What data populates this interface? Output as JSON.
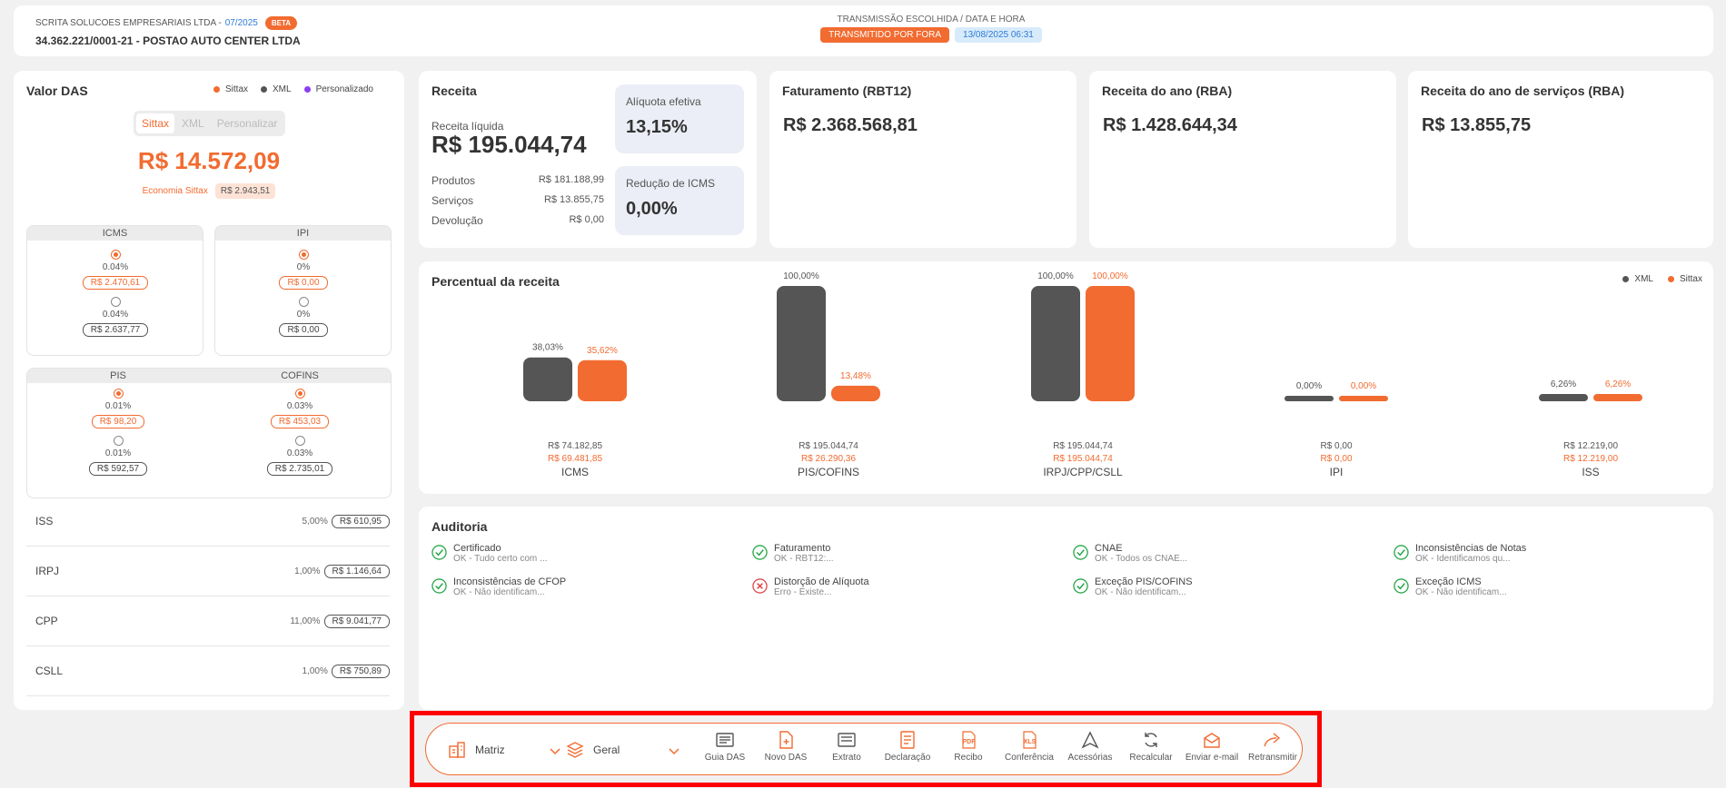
{
  "header": {
    "company": "SCRITA SOLUCOES EMPRESARIAIS LTDA -",
    "period": "07/2025",
    "beta": "BETA",
    "cnpj": "34.362.221/0001-21 - POSTAO AUTO CENTER LTDA",
    "transmission_label": "TRANSMISSÃO ESCOLHIDA / DATA E HORA",
    "transmission_status": "TRANSMITIDO POR FORA",
    "transmission_date": "13/08/2025 06:31"
  },
  "das": {
    "title": "Valor DAS",
    "legend": [
      {
        "label": "Sittax",
        "color": "#f26b30"
      },
      {
        "label": "XML",
        "color": "#555555"
      },
      {
        "label": "Personalizado",
        "color": "#8b3df2"
      }
    ],
    "tabs": [
      "Sittax",
      "XML",
      "Personalizar"
    ],
    "active_tab": "Sittax",
    "value": "R$ 14.572,09",
    "economy_label": "Economia Sittax",
    "economy_value": "R$ 2.943,51",
    "taxes": {
      "icms": {
        "title": "ICMS",
        "p1": "0.04%",
        "v1": "R$ 2.470,61",
        "p2": "0.04%",
        "v2": "R$ 2.637,77"
      },
      "ipi": {
        "title": "IPI",
        "p1": "0%",
        "v1": "R$ 0,00",
        "p2": "0%",
        "v2": "R$ 0,00"
      },
      "pis": {
        "title": "PIS",
        "p1": "0.01%",
        "v1": "R$ 98,20",
        "p2": "0.01%",
        "v2": "R$ 592,57"
      },
      "cofins": {
        "title": "COFINS",
        "p1": "0.03%",
        "v1": "R$ 453,03",
        "p2": "0.03%",
        "v2": "R$ 2.735,01"
      }
    },
    "rows": [
      {
        "name": "ISS",
        "pct": "5,00%",
        "value": "R$ 610,95"
      },
      {
        "name": "IRPJ",
        "pct": "1,00%",
        "value": "R$ 1.146,64"
      },
      {
        "name": "CPP",
        "pct": "11,00%",
        "value": "R$ 9.041,77"
      },
      {
        "name": "CSLL",
        "pct": "1,00%",
        "value": "R$ 750,89"
      }
    ]
  },
  "receita": {
    "title": "Receita",
    "liquida_label": "Receita líquida",
    "liquida_value": "R$ 195.044,74",
    "lines": [
      {
        "label": "Produtos",
        "value": "R$ 181.188,99"
      },
      {
        "label": "Serviços",
        "value": "R$ 13.855,75"
      },
      {
        "label": "Devolução",
        "value": "R$ 0,00"
      }
    ],
    "aliquota_label": "Alíquota efetiva",
    "aliquota_value": "13,15%",
    "reducao_label": "Redução de ICMS",
    "reducao_value": "0,00%"
  },
  "kpis": [
    {
      "title": "Faturamento (RBT12)",
      "value": "R$ 2.368.568,81"
    },
    {
      "title": "Receita do ano (RBA)",
      "value": "R$ 1.428.644,34"
    },
    {
      "title": "Receita do ano de serviços (RBA)",
      "value": "R$ 13.855,75"
    }
  ],
  "percentual": {
    "title": "Percentual da receita",
    "legend": [
      {
        "label": "XML",
        "color": "#555555"
      },
      {
        "label": "Sittax",
        "color": "#f26b30"
      }
    ]
  },
  "chart_data": {
    "type": "bar",
    "categories": [
      "ICMS",
      "PIS/COFINS",
      "IRPJ/CPP/CSLL",
      "IPI",
      "ISS"
    ],
    "series": [
      {
        "name": "XML",
        "color": "#555555",
        "values": [
          38.03,
          100,
          100,
          0,
          6.26
        ],
        "labels": [
          "38,03%",
          "100,00%",
          "100,00%",
          "0,00%",
          "6,26%"
        ],
        "amounts": [
          "R$ 74.182,85",
          "R$ 195.044,74",
          "R$ 195.044,74",
          "R$ 0,00",
          "R$ 12.219,00"
        ]
      },
      {
        "name": "Sittax",
        "color": "#f26b30",
        "values": [
          35.62,
          13.48,
          100,
          0,
          6.26
        ],
        "labels": [
          "35,62%",
          "13,48%",
          "100,00%",
          "0,00%",
          "6,26%"
        ],
        "amounts": [
          "R$ 69.481,85",
          "R$ 26.290,36",
          "R$ 195.044,74",
          "R$ 0,00",
          "R$ 12.219,00"
        ]
      }
    ],
    "ylim": [
      0,
      100
    ]
  },
  "auditoria": {
    "title": "Auditoria",
    "items": [
      {
        "title": "Certificado",
        "sub": "OK - Tudo certo com ...",
        "status": "ok"
      },
      {
        "title": "Faturamento",
        "sub": "OK - RBT12:...",
        "status": "ok"
      },
      {
        "title": "CNAE",
        "sub": "OK - Todos os CNAE...",
        "status": "ok"
      },
      {
        "title": "Inconsistências de Notas",
        "sub": "OK - Identificamos qu...",
        "status": "ok"
      },
      {
        "title": "Inconsistências de CFOP",
        "sub": "OK - Não identificam...",
        "status": "ok"
      },
      {
        "title": "Distorção de Alíquota",
        "sub": "Erro - Existe...",
        "status": "error"
      },
      {
        "title": "Exceção PIS/COFINS",
        "sub": "OK - Não identificam...",
        "status": "ok"
      },
      {
        "title": "Exceção ICMS",
        "sub": "OK - Não identificam...",
        "status": "ok"
      }
    ]
  },
  "toolbar": {
    "matriz": "Matriz",
    "geral": "Geral",
    "buttons": [
      "Guia DAS",
      "Novo DAS",
      "Extrato",
      "Declaração",
      "Recibo",
      "Conferência",
      "Acessórias",
      "Recalcular",
      "Enviar e-mail",
      "Retransmitir"
    ]
  }
}
